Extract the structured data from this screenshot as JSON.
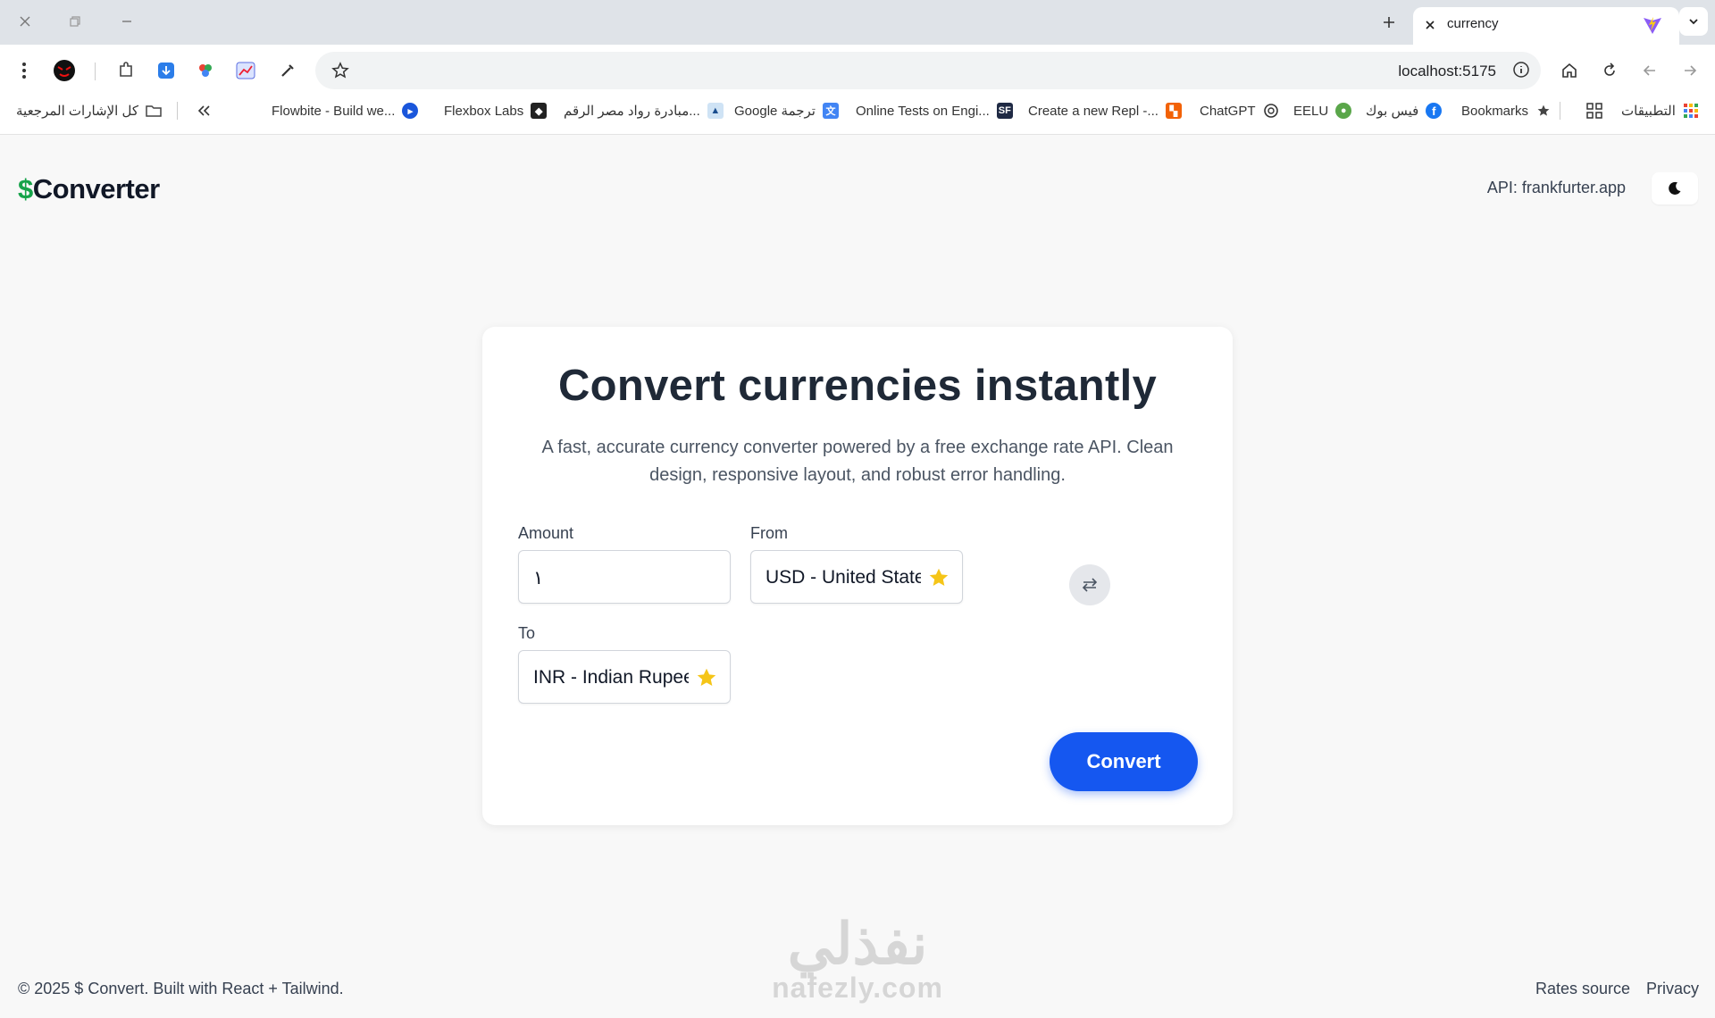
{
  "browser": {
    "tab_title": "currency",
    "url": "localhost:5175",
    "bookmarks": {
      "all_bookmarks": "كل الإشارات المرجعية",
      "flowbite": "Flowbite - Build we...",
      "flexbox": "Flexbox Labs",
      "rowad": "مبادرة رواد مصر الرقم...",
      "google_translate": "Google ترجمة",
      "online_tests": "Online Tests on Engi...",
      "repl": "Create a new Repl -...",
      "chatgpt": "ChatGPT",
      "eelu": "EELU",
      "facebook": "فيس بوك",
      "bookmarks": "Bookmarks",
      "apps": "التطبيقات"
    }
  },
  "header": {
    "logo_symbol": "$",
    "logo_text": "Converter",
    "api_label": "API: frankfurter.app"
  },
  "card": {
    "title": "Convert currencies instantly",
    "subtitle": "A fast, accurate currency converter powered by a free exchange rate API. Clean design, responsive layout, and robust error handling.",
    "amount_label": "Amount",
    "amount_value": "١",
    "from_label": "From",
    "from_value": "USD - United States",
    "to_label": "To",
    "to_value": "INR - Indian Rupee",
    "convert_label": "Convert"
  },
  "footer": {
    "copyright": "© 2025 $ Convert. Built with React + Tailwind.",
    "rates_source": "Rates source",
    "privacy": "Privacy"
  },
  "watermark": {
    "arabic": "نفذلي",
    "latin": "nafezly.com"
  },
  "colors": {
    "accent": "#1557f0",
    "logo_dollar": "#16a34a",
    "star": "#f5c518"
  }
}
